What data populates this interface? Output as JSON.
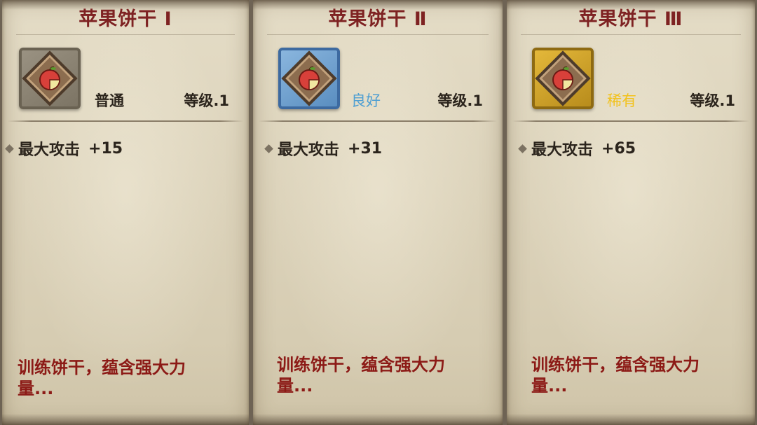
{
  "cards": [
    {
      "title": "苹果饼干 Ⅰ",
      "icon": "apple-cookie-icon",
      "frame_color": "#8c8474",
      "quality": "普通",
      "quality_color": "#2b241c",
      "level": "等级.1",
      "stat_label": "最大攻击",
      "stat_value": "+15",
      "description": "训练饼干，蕴含强大力量..."
    },
    {
      "title": "苹果饼干 Ⅱ",
      "icon": "apple-cookie-icon",
      "frame_color": "#5a8ec0",
      "quality": "良好",
      "quality_color": "#4f9fd2",
      "level": "等级.1",
      "stat_label": "最大攻击",
      "stat_value": "+31",
      "description": "训练饼干，蕴含强大力量..."
    },
    {
      "title": "苹果饼干 Ⅲ",
      "icon": "apple-cookie-icon",
      "frame_color": "#d4a52a",
      "quality": "稀有",
      "quality_color": "#f2c21c",
      "level": "等级.1",
      "stat_label": "最大攻击",
      "stat_value": "+65",
      "description": "训练饼干，蕴含强大力量..."
    }
  ]
}
